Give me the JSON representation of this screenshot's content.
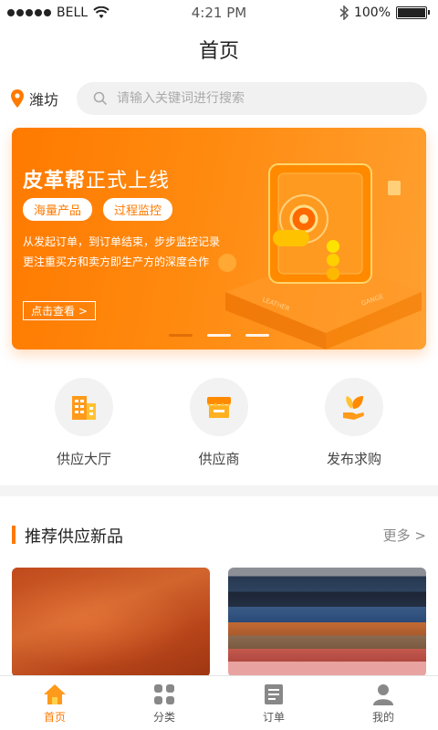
{
  "status_bar": {
    "carrier": "BELL",
    "time": "4:21 PM",
    "battery": "100%",
    "battery_level": 1.0
  },
  "nav": {
    "title": "首页"
  },
  "location": {
    "city": "潍坊",
    "icon": "location-pin-icon"
  },
  "search": {
    "placeholder": "请输入关键词进行搜索",
    "value": "",
    "icon": "search-icon"
  },
  "banner": {
    "title_bold": "皮革帮",
    "title_rest": "正式上线",
    "chips": [
      "海量产品",
      "过程监控"
    ],
    "desc_line1": "从发起订单，到订单结束，步步监控记录",
    "desc_line2": "更注重买方和卖方即生产方的深度合作",
    "button": "点击查看 >",
    "art_text_left": "LEATHER",
    "art_text_right": "GANGE",
    "active_slide": 1,
    "slide_count": 3
  },
  "entries": [
    {
      "label": "供应大厅",
      "icon": "building-icon"
    },
    {
      "label": "供应商",
      "icon": "store-icon"
    },
    {
      "label": "发布求购",
      "icon": "hand-leaf-icon"
    }
  ],
  "section": {
    "title": "推荐供应新品",
    "more": "更多 >"
  },
  "tabs": [
    {
      "label": "首页",
      "icon": "home-icon",
      "active": true
    },
    {
      "label": "分类",
      "icon": "grid-icon",
      "active": false
    },
    {
      "label": "订单",
      "icon": "order-icon",
      "active": false
    },
    {
      "label": "我的",
      "icon": "user-icon",
      "active": false
    }
  ],
  "colors": {
    "accent": "#ff7a00",
    "banner_start": "#ff7a00",
    "banner_end": "#ffa030"
  }
}
